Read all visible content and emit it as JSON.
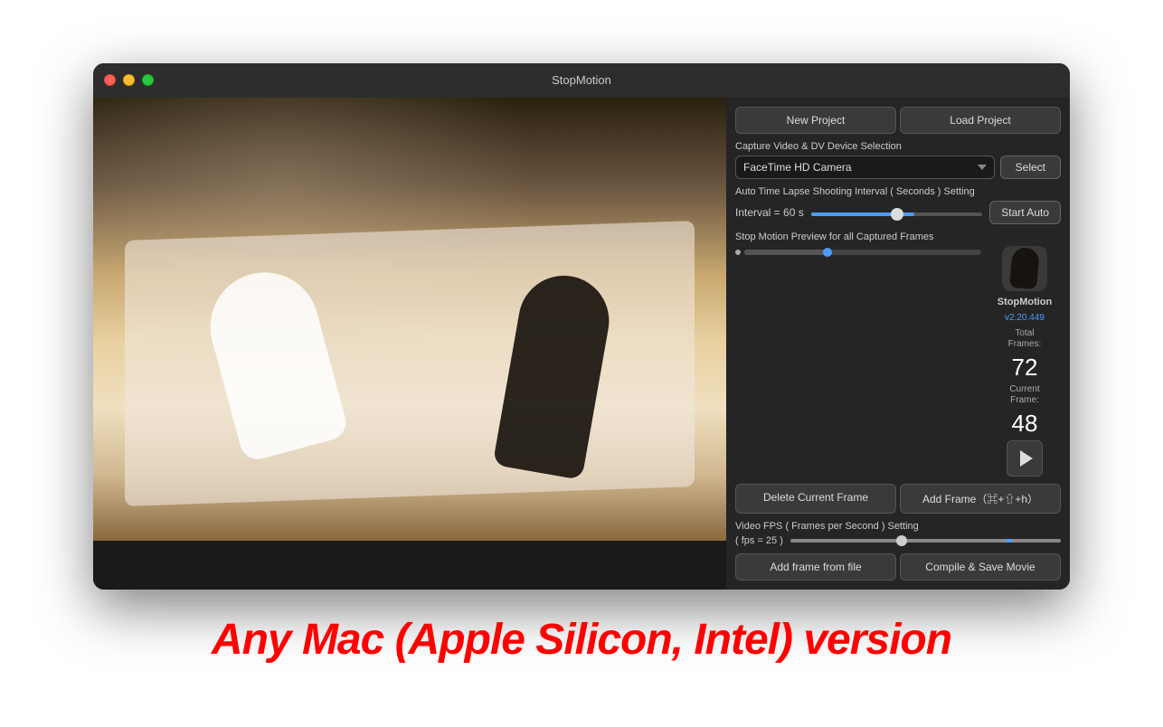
{
  "window": {
    "title": "StopMotion"
  },
  "traffic_lights": {
    "close_label": "close",
    "minimize_label": "minimize",
    "maximize_label": "maximize"
  },
  "header": {
    "new_project_label": "New  Project",
    "load_project_label": "Load  Project"
  },
  "device_section": {
    "label": "Capture Video & DV Device Selection",
    "dropdown_value": "FaceTime HD Camera",
    "select_button_label": "Select"
  },
  "interval_section": {
    "label": "Auto Time Lapse Shooting Interval ( Seconds ) Setting",
    "value_label": "Interval = 60 s",
    "slider_value": 60,
    "start_button_label": "Start Auto"
  },
  "preview_section": {
    "label": "Stop Motion Preview for all Captured Frames",
    "app_name": "StopMotion",
    "app_version": "v2.20.449",
    "total_frames_label": "Total\nFrames:",
    "total_frames_value": "72",
    "current_frame_label": "Current\nFrame:",
    "current_frame_value": "48"
  },
  "frame_actions": {
    "delete_label": "Delete Current Frame",
    "add_label": "Add Frame（⌘+⇧+h）"
  },
  "fps_section": {
    "label": "Video FPS ( Frames per Second ) Setting",
    "value_label": "( fps = 25 )"
  },
  "bottom_actions": {
    "add_file_label": "Add frame from file",
    "compile_label": "Compile & Save Movie"
  },
  "promo": {
    "text": "Any Mac (Apple Silicon, Intel) version"
  }
}
